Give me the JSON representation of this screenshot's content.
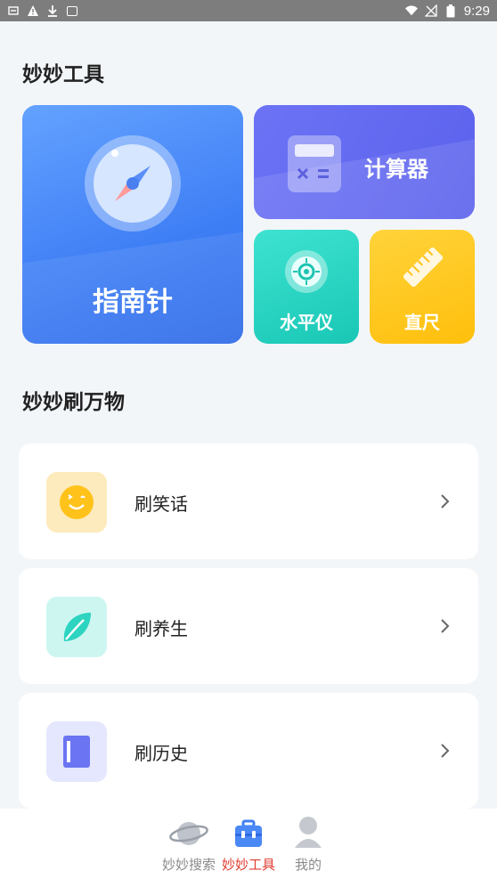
{
  "status_bar": {
    "time": "9:29"
  },
  "tools_section": {
    "title": "妙妙工具"
  },
  "tools": {
    "compass": {
      "label": "指南针",
      "icon": "compass-icon"
    },
    "calculator": {
      "label": "计算器",
      "icon": "calculator-icon"
    },
    "level": {
      "label": "水平仪",
      "icon": "level-icon"
    },
    "ruler": {
      "label": "直尺",
      "icon": "ruler-icon"
    }
  },
  "browse_section": {
    "title": "妙妙刷万物"
  },
  "browse_items": [
    {
      "label": "刷笑话",
      "icon": "smiley-icon",
      "color": "#fde9b8"
    },
    {
      "label": "刷养生",
      "icon": "leaf-icon",
      "color": "#c9f5f0"
    },
    {
      "label": "刷历史",
      "icon": "book-icon",
      "color": "#e3e6fd"
    }
  ],
  "bottom_nav": {
    "items": [
      {
        "label": "妙妙搜索",
        "icon": "planet-icon"
      },
      {
        "label": "妙妙工具",
        "icon": "toolbox-icon"
      },
      {
        "label": "我的",
        "icon": "profile-icon"
      }
    ],
    "active_color": "#e03c31"
  }
}
